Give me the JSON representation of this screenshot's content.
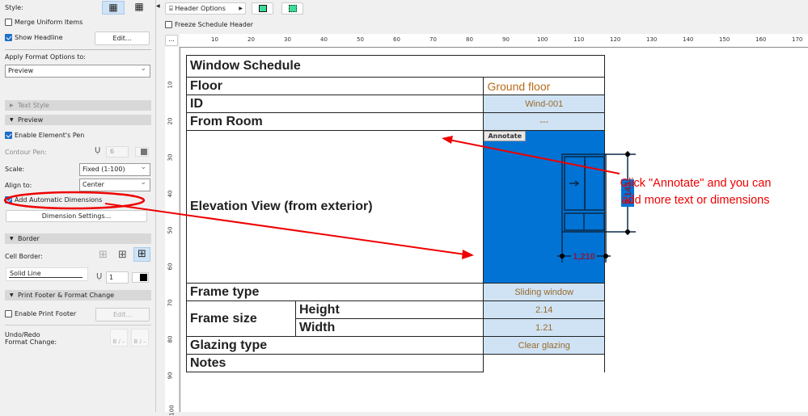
{
  "left_panel": {
    "style_label": "Style:",
    "merge_uniform": {
      "label": "Merge Uniform Items",
      "checked": false
    },
    "show_headline": {
      "label": "Show Headline",
      "checked": true
    },
    "edit_label": "Edit...",
    "apply_format_label": "Apply Format Options to:",
    "apply_format_value": "Preview",
    "text_style_section": "Text Style",
    "preview_section": "Preview",
    "enable_pen": {
      "label": "Enable Element's Pen",
      "checked": true
    },
    "contour_pen_label": "Contour Pen:",
    "contour_pen_value": "6",
    "scale_label": "Scale:",
    "scale_value": "Fixed (1:100)",
    "align_label": "Align to:",
    "align_value": "Center",
    "auto_dims": {
      "label": "Add Automatic Dimensions",
      "checked": true
    },
    "dim_settings_label": "Dimension Settings...",
    "border_section": "Border",
    "cell_border_label": "Cell Border:",
    "line_type": "Solid Line",
    "border_pen_value": "1",
    "print_footer_section": "Print Footer & Format Change",
    "enable_print_footer": {
      "label": "Enable Print Footer",
      "checked": false
    },
    "footer_edit_label": "Edit...",
    "undo_redo_label": "Undo/Redo",
    "format_change_label": "Format Change:",
    "undo_glyph": "B / –",
    "redo_glyph": "B / –"
  },
  "toolbar": {
    "header_options": "Header Options",
    "freeze_header": {
      "label": "Freeze Schedule Header",
      "checked": false
    },
    "more": "..."
  },
  "ruler": {
    "h_ticks": [
      "10",
      "20",
      "30",
      "40",
      "50",
      "60",
      "70",
      "80",
      "90",
      "100",
      "110",
      "120",
      "130",
      "140",
      "150",
      "160",
      "170"
    ],
    "v_ticks": [
      "10",
      "20",
      "30",
      "40",
      "50",
      "60",
      "70",
      "80",
      "90",
      "100"
    ]
  },
  "schedule": {
    "title": "Window Schedule",
    "rows": {
      "floor": {
        "label": "Floor",
        "value": "Ground floor"
      },
      "id": {
        "label": "ID",
        "value": "Wind-001"
      },
      "from_room": {
        "label": "From Room",
        "value": "---"
      },
      "elevation": {
        "label": "Elevation View (from exterior)",
        "annotate": "Annotate",
        "dim_width": "1,210",
        "dim_height": "2,143"
      },
      "frame_type": {
        "label": "Frame type",
        "value": "Sliding window"
      },
      "frame_size": {
        "label": "Frame size",
        "height_label": "Height",
        "height_value": "2.14",
        "width_label": "Width",
        "width_value": "1.21"
      },
      "glazing": {
        "label": "Glazing type",
        "value": "Clear glazing"
      },
      "notes": {
        "label": "Notes",
        "value": ""
      }
    }
  },
  "annotation_note": "Click \"Annotate\" and you can add more text or dimensions",
  "colors": {
    "preview_bg": "#0073d4",
    "value_cell": "#cfe3f5",
    "annotation": "#e00000"
  }
}
